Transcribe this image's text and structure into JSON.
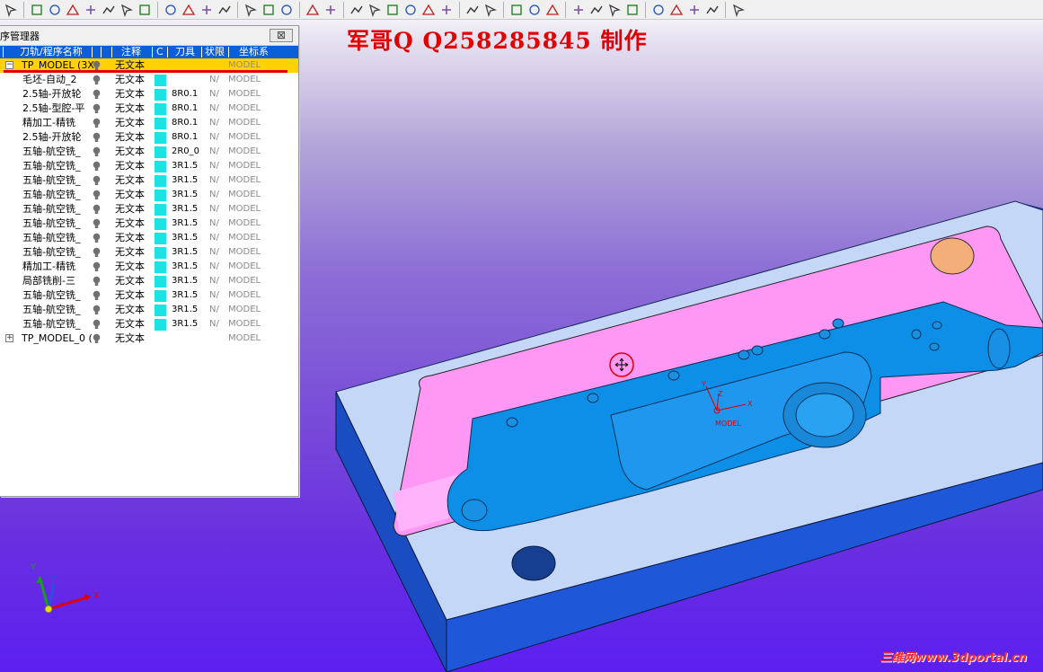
{
  "toolbar": {
    "icons": [
      "select-icon",
      "pick-icon",
      "filter-icon",
      "wireframe-icon",
      "view-icon",
      "layer-icon",
      "dimension-icon",
      "arrow-icon",
      "group-icon",
      "database-icon",
      "table-icon",
      "shaded-icon",
      "circle-icon",
      "tool-icon",
      "swap-icon",
      "box-icon",
      "link-icon",
      "edit-icon",
      "path-icon",
      "surface-icon",
      "edge-icon",
      "axis-icon",
      "coord-icon",
      "coord2-icon",
      "coord3-icon",
      "line-icon",
      "spline-icon",
      "arc-icon",
      "trim-icon",
      "plane-icon",
      "stroke-icon",
      "cross-icon",
      "angle-icon",
      "cursor-icon",
      "frame-icon",
      "close-icon",
      "back-icon"
    ]
  },
  "explorer": {
    "title": "序管理器",
    "close_label": "⊠",
    "columns": {
      "name": "刀轨/程序名称",
      "note": "注释",
      "c": "C",
      "tool": "刀具",
      "limit": "状限",
      "coord": "坐标系"
    },
    "rows": [
      {
        "name": "TP_MODEL (3X",
        "note": "无文本",
        "tool": "",
        "limit": "",
        "coord": "MODEL",
        "expander": "−"
      },
      {
        "name": "毛坯-自动_2",
        "note": "无文本",
        "tool": "",
        "limit": "N/",
        "coord": "MODEL"
      },
      {
        "name": "2.5轴-开放轮",
        "note": "无文本",
        "tool": "8R0.1",
        "limit": "N/",
        "coord": "MODEL"
      },
      {
        "name": "2.5轴-型腔-平",
        "note": "无文本",
        "tool": "8R0.1",
        "limit": "N/",
        "coord": "MODEL"
      },
      {
        "name": "精加工-精铣",
        "note": "无文本",
        "tool": "8R0.1",
        "limit": "N/",
        "coord": "MODEL"
      },
      {
        "name": "2.5轴-开放轮",
        "note": "无文本",
        "tool": "8R0.1",
        "limit": "N/",
        "coord": "MODEL"
      },
      {
        "name": "五轴-航空铣_",
        "note": "无文本",
        "tool": "2R0_0",
        "limit": "N/",
        "coord": "MODEL"
      },
      {
        "name": "五轴-航空铣_",
        "note": "无文本",
        "tool": "3R1.5",
        "limit": "N/",
        "coord": "MODEL"
      },
      {
        "name": "五轴-航空铣_",
        "note": "无文本",
        "tool": "3R1.5",
        "limit": "N/",
        "coord": "MODEL"
      },
      {
        "name": "五轴-航空铣_",
        "note": "无文本",
        "tool": "3R1.5",
        "limit": "N/",
        "coord": "MODEL"
      },
      {
        "name": "五轴-航空铣_",
        "note": "无文本",
        "tool": "3R1.5",
        "limit": "N/",
        "coord": "MODEL"
      },
      {
        "name": "五轴-航空铣_",
        "note": "无文本",
        "tool": "3R1.5",
        "limit": "N/",
        "coord": "MODEL"
      },
      {
        "name": "五轴-航空铣_",
        "note": "无文本",
        "tool": "3R1.5",
        "limit": "N/",
        "coord": "MODEL"
      },
      {
        "name": "五轴-航空铣_",
        "note": "无文本",
        "tool": "3R1.5",
        "limit": "N/",
        "coord": "MODEL"
      },
      {
        "name": "精加工-精铣",
        "note": "无文本",
        "tool": "3R1.5",
        "limit": "N/",
        "coord": "MODEL"
      },
      {
        "name": "局部铣削-三",
        "note": "无文本",
        "tool": "3R1.5",
        "limit": "N/",
        "coord": "MODEL"
      },
      {
        "name": "五轴-航空铣_",
        "note": "无文本",
        "tool": "3R1.5",
        "limit": "N/",
        "coord": "MODEL"
      },
      {
        "name": "五轴-航空铣_",
        "note": "无文本",
        "tool": "3R1.5",
        "limit": "N/",
        "coord": "MODEL"
      },
      {
        "name": "五轴-航空铣_",
        "note": "无文本",
        "tool": "3R1.5",
        "limit": "N/",
        "coord": "MODEL"
      },
      {
        "name": "TP_MODEL_0 (",
        "note": "无文本",
        "tool": "",
        "limit": "",
        "coord": "MODEL",
        "expander": "+"
      }
    ]
  },
  "viewport": {
    "watermark": "军哥Q Q258285845 制作",
    "site_tag": "三维网www.3dportal.cn",
    "model_label": "MODEL",
    "csys_labels": {
      "x": "X",
      "y": "Y",
      "z": "Z"
    },
    "triad_labels": {
      "x": "X",
      "y": "Y",
      "z": "Z"
    }
  }
}
